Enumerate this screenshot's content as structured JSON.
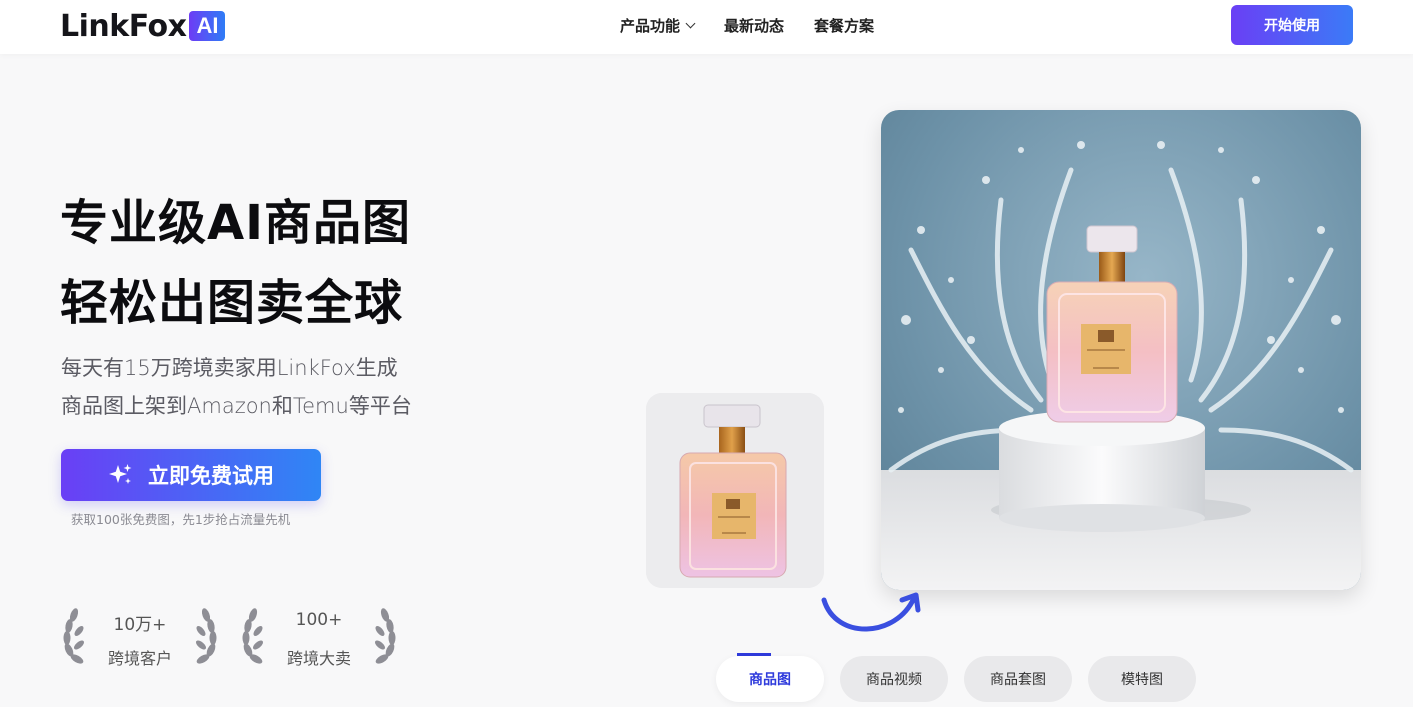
{
  "header": {
    "logo_text": "LinkFox",
    "logo_badge": "AI",
    "nav": [
      {
        "label": "产品功能",
        "has_dropdown": true
      },
      {
        "label": "最新动态",
        "has_dropdown": false
      },
      {
        "label": "套餐方案",
        "has_dropdown": false
      }
    ],
    "start_button": "开始使用"
  },
  "hero": {
    "title_line1": "专业级AI商品图",
    "title_line2": "轻松出图卖全球",
    "subtitle_line1": "每天有15万跨境卖家用LinkFox生成",
    "subtitle_line2": "商品图上架到Amazon和Temu等平台",
    "cta_label": "立即免费试用",
    "cta_icon": "sparkle-icon",
    "cta_note": "获取100张免费图，先1步抢占流量先机"
  },
  "stats": [
    {
      "value": "10万+",
      "label": "跨境客户"
    },
    {
      "value": "100+",
      "label": "跨境大卖"
    }
  ],
  "showcase": {
    "tabs": [
      {
        "label": "商品图",
        "active": true
      },
      {
        "label": "商品视频",
        "active": false
      },
      {
        "label": "商品套图",
        "active": false
      },
      {
        "label": "模特图",
        "active": false
      }
    ]
  },
  "colors": {
    "brand_start": "#6a3ff5",
    "brand_end": "#2f86f5",
    "tab_active": "#2f3bdc"
  }
}
